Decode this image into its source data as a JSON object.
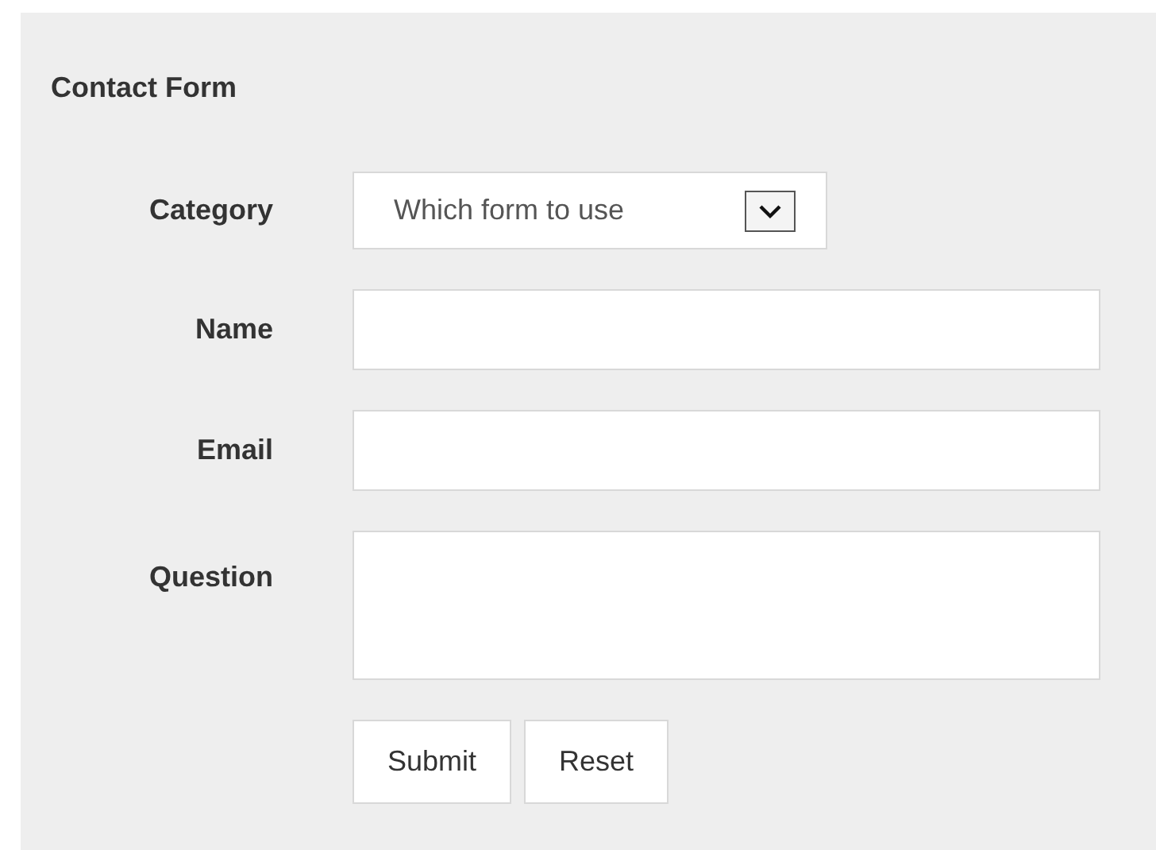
{
  "form": {
    "title": "Contact Form",
    "fields": [
      {
        "kind": "select",
        "label": "Category",
        "value": "Which form to use"
      },
      {
        "kind": "text",
        "label": "Name"
      },
      {
        "kind": "text",
        "label": "Email"
      },
      {
        "kind": "textarea",
        "label": "Question"
      }
    ],
    "buttons": [
      "Submit",
      "Reset"
    ]
  }
}
